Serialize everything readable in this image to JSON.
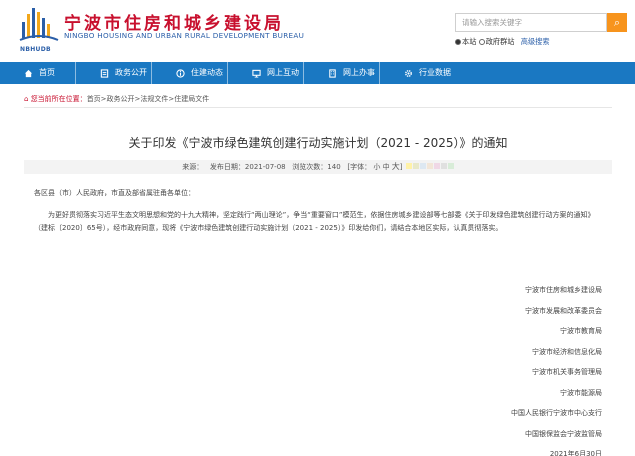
{
  "header": {
    "site_title": "宁波市住房和城乡建设局",
    "site_subtitle": "NINGBO HOUSING AND URBAN RURAL DEVELOPMENT BUREAU",
    "logo_text": "NBHUDB",
    "search_placeholder": "请输入搜索关键字",
    "scope_this_site": "本站",
    "scope_group": "政府群站",
    "advanced_search": "高级搜索"
  },
  "nav": {
    "items": [
      {
        "label": "首页"
      },
      {
        "label": "政务公开"
      },
      {
        "label": "住建动态"
      },
      {
        "label": "网上互动"
      },
      {
        "label": "网上办事"
      },
      {
        "label": "行业数据"
      }
    ]
  },
  "breadcrumb": {
    "prefix": "您当前所在位置：",
    "path": "首页>政务公开>法规文件>住建局文件"
  },
  "article": {
    "title": "关于印发《宁波市绿色建筑创建行动实施计划（2021 - 2025）》的通知",
    "source_label": "来源：",
    "date_label": "发布日期：",
    "date": "2021-07-08",
    "views_label": "浏览次数：",
    "views": "140",
    "font_label": "[字体：",
    "font_small": "小",
    "font_medium": "中",
    "font_large": "大",
    "font_close": "]",
    "swatch_colors": [
      "#fff2a8",
      "#e8e8c8",
      "#dde8f2",
      "#f2e6d8",
      "#f0d8e6",
      "#e0e0e0",
      "#d8ecd8"
    ],
    "addressee": "各区县（市）人民政府，市直及部省属驻甬各单位：",
    "para1": "为更好贯彻落实习近平生态文明思想和党的十九大精神，坚定践行“两山理论”，争当“重要窗口”模范生，依据住房城乡建设部等七部委《关于印发绿色建筑创建行动方案的通知》（建标〔2020〕65号），经市政府同意，现将《宁波市绿色建筑创建行动实施计划（2021 - 2025）》印发给你们，请结合本地区实际，认真贯彻落实。",
    "signers": [
      "宁波市住房和城乡建设局",
      "宁波市发展和改革委员会",
      "宁波市教育局",
      "宁波市经济和信息化局",
      "宁波市机关事务管理局",
      "宁波市能源局",
      "中国人民银行宁波市中心支行",
      "中国银保监会宁波监管局",
      "2021年6月30日"
    ]
  }
}
